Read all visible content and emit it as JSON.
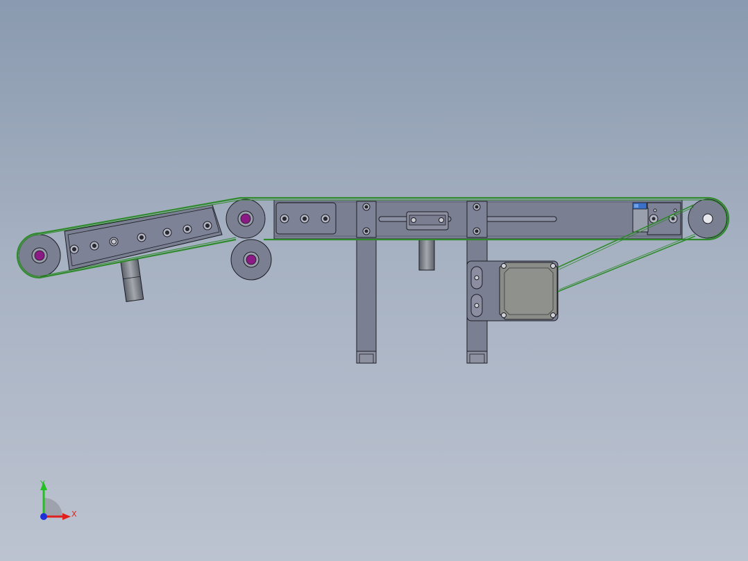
{
  "view": {
    "background_top": "#8a9aaf",
    "background_bottom": "#bcc3d0"
  },
  "model": {
    "part_color": "#7b7f92",
    "edge_color": "#1c1c24",
    "belt_color": "#2f8a2c",
    "hub_color": "#8b1a85",
    "motor_color": "#8a8c88",
    "sensor_color": "#3a70c8"
  },
  "triad": {
    "x_label": "X",
    "y_label": "Y",
    "x_color": "#e0201c",
    "y_color": "#22c022",
    "z_color": "#2030d8"
  }
}
